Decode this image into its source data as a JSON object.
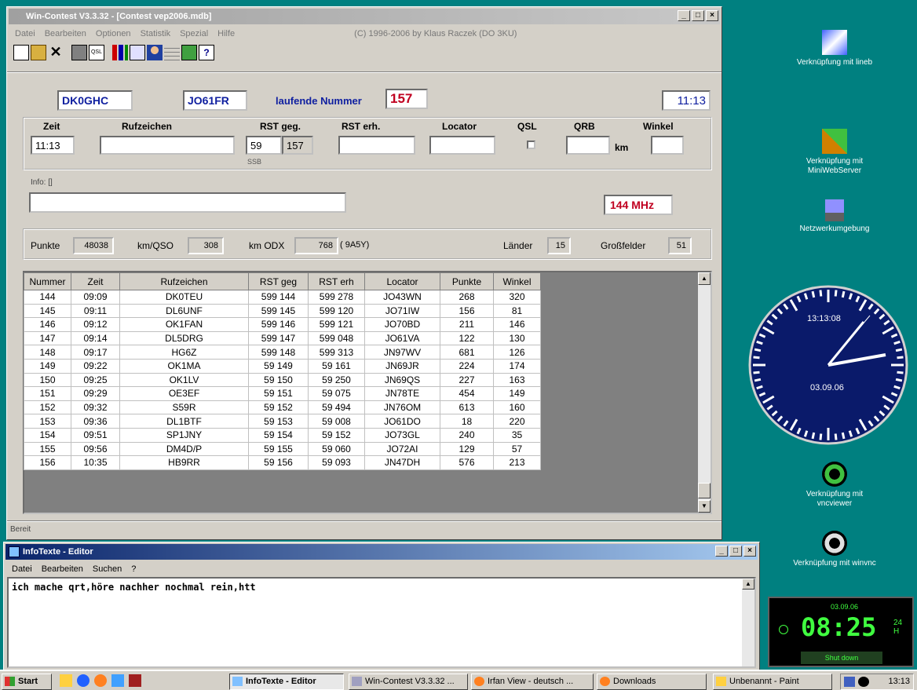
{
  "main_window": {
    "title": "Win-Contest V3.3.32 - [Contest     vep2006.mdb]",
    "menu": [
      "Datei",
      "Bearbeiten",
      "Optionen",
      "Statistik",
      "Spezial",
      "Hilfe"
    ],
    "copyright": "(C) 1996-2006 by Klaus Raczek (DO 3KU)",
    "toolbar_icons": [
      "new-icon",
      "open-icon",
      "delete-icon",
      "print-icon",
      "qsl-icon",
      "stats-icon",
      "copy-icon",
      "person-icon",
      "grid-icon",
      "map-icon",
      "help-icon"
    ],
    "callsign": "DK0GHC",
    "locator": "JO61FR",
    "serial_label": "laufende Nummer",
    "serial_value": "157",
    "clock": "11:13",
    "entry": {
      "zeit_label": "Zeit",
      "zeit_value": "11:13",
      "rufzeichen_label": "Rufzeichen",
      "rufzeichen_value": "",
      "rst_geg_label": "RST geg.",
      "rst_geg_value": "59",
      "rst_geg_nr": "157",
      "mode": "SSB",
      "rst_erh_label": "RST erh.",
      "rst_erh_value": "",
      "locator_label": "Locator",
      "locator_value": "",
      "qsl_label": "QSL",
      "qrb_label": "QRB",
      "qrb_value": "",
      "qrb_unit": "km",
      "winkel_label": "Winkel",
      "winkel_value": ""
    },
    "info_label": "Info: []",
    "info_value": "",
    "band": "144 MHz",
    "stats": {
      "punkte_label": "Punkte",
      "punkte_value": "48038",
      "kmqso_label": "km/QSO",
      "kmqso_value": "308",
      "kmodx_label": "km ODX",
      "kmodx_value": "768",
      "kmodx_call": "( 9A5Y)",
      "laender_label": "Länder",
      "laender_value": "15",
      "gross_label": "Großfelder",
      "gross_value": "51"
    },
    "table": {
      "headers": [
        "Nummer",
        "Zeit",
        "Rufzeichen",
        "RST geg",
        "RST erh",
        "Locator",
        "Punkte",
        "Winkel"
      ],
      "rows": [
        [
          "144",
          "09:09",
          "DK0TEU",
          "599 144",
          "599 278",
          "JO43WN",
          "268",
          "320"
        ],
        [
          "145",
          "09:11",
          "DL6UNF",
          "599 145",
          "599 120",
          "JO71IW",
          "156",
          "81"
        ],
        [
          "146",
          "09:12",
          "OK1FAN",
          "599 146",
          "599 121",
          "JO70BD",
          "211",
          "146"
        ],
        [
          "147",
          "09:14",
          "DL5DRG",
          "599 147",
          "599 048",
          "JO61VA",
          "122",
          "130"
        ],
        [
          "148",
          "09:17",
          "HG6Z",
          "599 148",
          "599 313",
          "JN97WV",
          "681",
          "126"
        ],
        [
          "149",
          "09:22",
          "OK1MA",
          "59 149",
          "59 161",
          "JN69JR",
          "224",
          "174"
        ],
        [
          "150",
          "09:25",
          "OK1LV",
          "59 150",
          "59 250",
          "JN69QS",
          "227",
          "163"
        ],
        [
          "151",
          "09:29",
          "OE3EF",
          "59 151",
          "59 075",
          "JN78TE",
          "454",
          "149"
        ],
        [
          "152",
          "09:32",
          "S59R",
          "59 152",
          "59 494",
          "JN76OM",
          "613",
          "160"
        ],
        [
          "153",
          "09:36",
          "DL1BTF",
          "59 153",
          "59 008",
          "JO61DO",
          "18",
          "220"
        ],
        [
          "154",
          "09:51",
          "SP1JNY",
          "59 154",
          "59 152",
          "JO73GL",
          "240",
          "35"
        ],
        [
          "155",
          "09:56",
          "DM4D/P",
          "59 155",
          "59 060",
          "JO72AI",
          "129",
          "57"
        ],
        [
          "156",
          "10:35",
          "HB9RR",
          "59 156",
          "59 093",
          "JN47DH",
          "576",
          "213"
        ]
      ]
    },
    "status": "Bereit"
  },
  "editor": {
    "title": "InfoTexte - Editor",
    "menu": [
      "Datei",
      "Bearbeiten",
      "Suchen",
      "?"
    ],
    "text": "ich mache qrt,höre nachher nochmal rein,htt"
  },
  "desktop": {
    "icons": [
      {
        "label": "Verknüpfung mit lineb",
        "icon": "network-app-icon"
      },
      {
        "label": "Verknüpfung mit MiniWebServer",
        "icon": "server-icon"
      },
      {
        "label": "Netzwerkumgebung",
        "icon": "network-icon"
      },
      {
        "label": "Verknüpfung mit vncviewer",
        "icon": "vnc-eye-icon"
      },
      {
        "label": "Verknüpfung mit winvnc",
        "icon": "vnc-eye-icon"
      }
    ],
    "analog_clock_time": "13:13:08",
    "analog_clock_date": "03.09.06",
    "digital_clock_date": "03.09.06",
    "digital_clock_time": "08:25",
    "digital_clock_mode": "24 H",
    "digital_clock_button": "Shut down"
  },
  "taskbar": {
    "start": "Start",
    "items": [
      "InfoTexte - Editor",
      "Win-Contest V3.3.32 ...",
      "Irfan View - deutsch ...",
      "Downloads",
      "Unbenannt - Paint"
    ],
    "clock": "13:13"
  }
}
